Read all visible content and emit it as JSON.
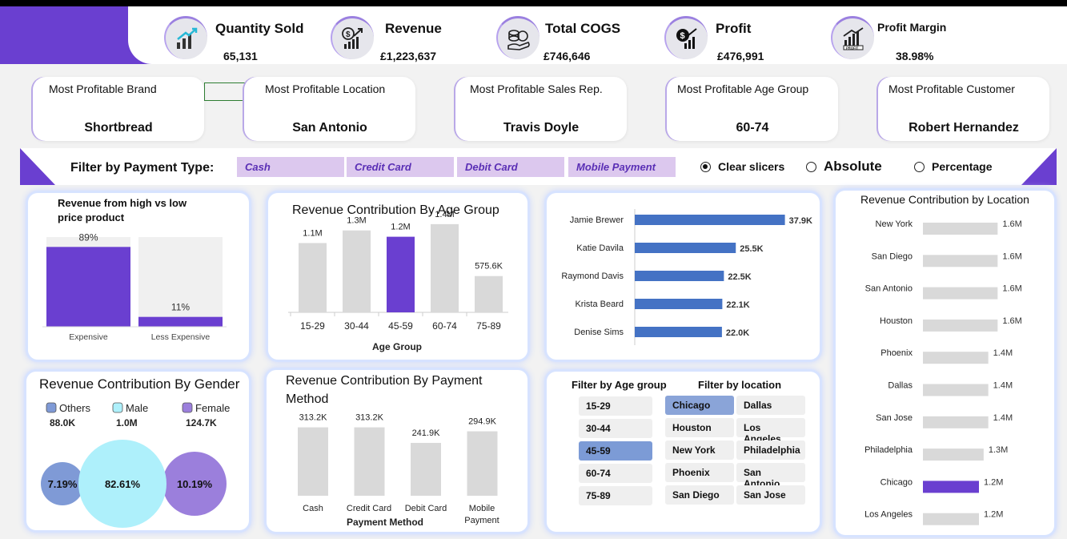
{
  "kpis": [
    {
      "label": "Quantity Sold",
      "value": "65,131",
      "icon": "chart-growth-icon"
    },
    {
      "label": "Revenue",
      "value": "£1,223,637",
      "icon": "revenue-chart-icon"
    },
    {
      "label": "Total COGS",
      "value": "£746,646",
      "icon": "coins-hand-icon"
    },
    {
      "label": "Profit",
      "value": "£476,991",
      "icon": "money-bag-chart-icon"
    },
    {
      "label": "Profit Margin",
      "value": "38.98%",
      "icon": "profit-chart-icon"
    }
  ],
  "most_profitable": [
    {
      "title": "Most Profitable Brand",
      "value": "Shortbread"
    },
    {
      "title": "Most Profitable Location",
      "value": "San Antonio"
    },
    {
      "title": "Most Profitable Sales Rep.",
      "value": "Travis Doyle"
    },
    {
      "title": "Most Profitable Age Group",
      "value": "60-74"
    },
    {
      "title": "Most Profitable Customer",
      "value": "Robert Hernandez"
    }
  ],
  "filter": {
    "label": "Filter by Payment Type:",
    "payment_types": [
      "Cash",
      "Credit Card",
      "Debit Card",
      "Mobile Payment"
    ],
    "clear_label": "Clear slicers",
    "absolute_label": "Absolute",
    "percentage_label": "Percentage",
    "selected_option": "Clear slicers"
  },
  "colors": {
    "accent": "#6a3fd0",
    "bar_grey": "#d9d9d9",
    "bar_blue": "#4472c4",
    "male": "#aef0fb",
    "others": "#7f9ad6",
    "female": "#9b7fdc"
  },
  "panels": {
    "price": {
      "title": "Revenue from high vs low price product"
    },
    "age": {
      "title": "Revenue Contribution By Age Group",
      "xlabel": "Age Group"
    },
    "reps": {
      "title": ""
    },
    "location": {
      "title": "Revenue Contribution by Location"
    },
    "gender": {
      "title": "Revenue Contribution By Gender"
    },
    "payment": {
      "title": "Revenue Contribution By Payment Method",
      "xlabel": "Payment Method"
    },
    "slicers": {
      "age_title": "Filter by Age group",
      "loc_title": "Filter by location"
    }
  },
  "slicers": {
    "age_groups": [
      "15-29",
      "30-44",
      "45-59",
      "60-74",
      "75-89"
    ],
    "age_selected": "45-59",
    "locations": [
      "Chicago",
      "Dallas",
      "Houston",
      "Los Angeles",
      "New York",
      "Philadelphia",
      "Phoenix",
      "San Antonio",
      "San Diego",
      "San Jose"
    ],
    "location_selected": "Chicago"
  },
  "chart_data": [
    {
      "id": "price",
      "type": "bar",
      "title": "Revenue from high vs low price product",
      "categories": [
        "Expensive",
        "Less Expensive"
      ],
      "values": [
        89,
        11
      ],
      "labels": [
        "89%",
        "11%"
      ],
      "ylim": [
        0,
        100
      ],
      "unit": "%"
    },
    {
      "id": "age",
      "type": "bar",
      "title": "Revenue Contribution By Age Group",
      "xlabel": "Age Group",
      "categories": [
        "15-29",
        "30-44",
        "45-59",
        "60-74",
        "75-89"
      ],
      "values": [
        1100000,
        1300000,
        1200000,
        1400000,
        575600
      ],
      "labels": [
        "1.1M",
        "1.3M",
        "1.2M",
        "1.4M",
        "575.6K"
      ],
      "highlight": "45-59"
    },
    {
      "id": "reps",
      "type": "bar",
      "orientation": "horizontal",
      "categories": [
        "Jamie Brewer",
        "Katie Davila",
        "Raymond Davis",
        "Krista Beard",
        "Denise Sims"
      ],
      "values": [
        37900,
        25500,
        22500,
        22100,
        22000
      ],
      "labels": [
        "37.9K",
        "25.5K",
        "22.5K",
        "22.1K",
        "22.0K"
      ]
    },
    {
      "id": "location",
      "type": "bar",
      "orientation": "horizontal",
      "title": "Revenue Contribution by Location",
      "categories": [
        "New York",
        "San Diego",
        "San Antonio",
        "Houston",
        "Phoenix",
        "Dallas",
        "San Jose",
        "Philadelphia",
        "Chicago",
        "Los Angeles"
      ],
      "values": [
        1600000,
        1600000,
        1600000,
        1600000,
        1400000,
        1400000,
        1400000,
        1300000,
        1200000,
        1200000
      ],
      "labels": [
        "1.6M",
        "1.6M",
        "1.6M",
        "1.6M",
        "1.4M",
        "1.4M",
        "1.4M",
        "1.3M",
        "1.2M",
        "1.2M"
      ],
      "highlight": "Chicago"
    },
    {
      "id": "gender",
      "type": "bubble",
      "title": "Revenue Contribution By Gender",
      "categories": [
        "Others",
        "Male",
        "Female"
      ],
      "values": [
        88000,
        1000000,
        124700
      ],
      "value_labels": [
        "88.0K",
        "1.0M",
        "124.7K"
      ],
      "percent_labels": [
        "7.19%",
        "82.61%",
        "10.19%"
      ]
    },
    {
      "id": "payment",
      "type": "bar",
      "title": "Revenue Contribution By Payment Method",
      "xlabel": "Payment Method",
      "categories": [
        "Cash",
        "Credit Card",
        "Debit Card",
        "Mobile Payment"
      ],
      "values": [
        313200,
        313200,
        241900,
        294900
      ],
      "labels": [
        "313.2K",
        "313.2K",
        "241.9K",
        "294.9K"
      ]
    }
  ]
}
